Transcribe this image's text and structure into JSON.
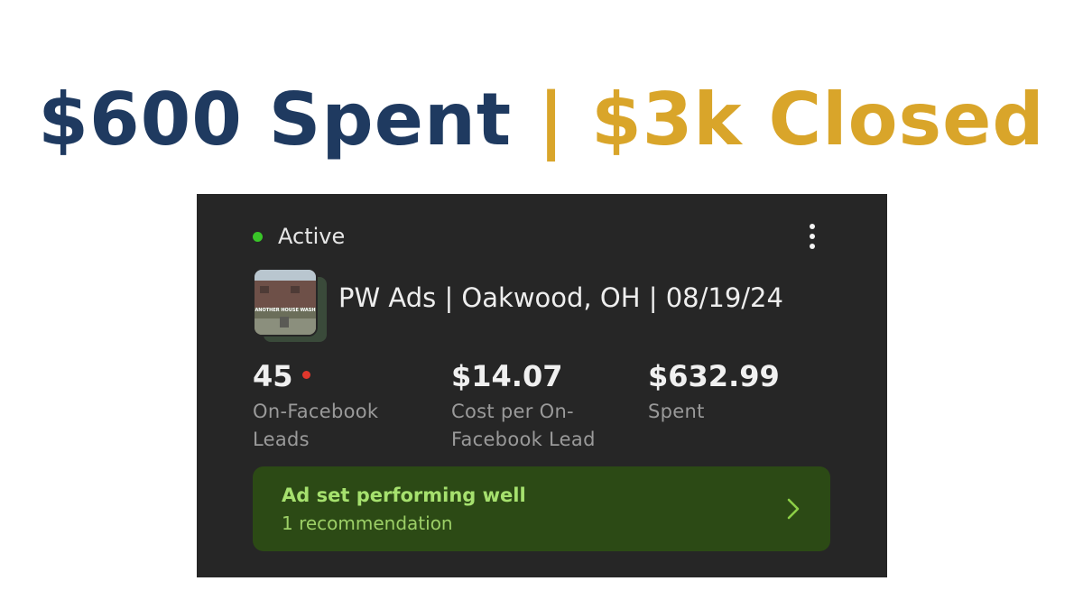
{
  "headline": {
    "spent_text": "$600 Spent",
    "closed_text": "| $3k Closed",
    "spent_color": "#1f3a60",
    "closed_color": "#d9a52a"
  },
  "card": {
    "status_label": "Active",
    "status_color": "#39c528",
    "menu_icon": "more-vertical-icon",
    "thumbnail_caption": "ANOTHER HOUSE WASH",
    "campaign_name": "PW Ads | Oakwood, OH | 08/19/24",
    "metrics": [
      {
        "value": "45",
        "label": "On-Facebook Leads",
        "has_alert_dot": true
      },
      {
        "value": "$14.07",
        "label": "Cost per On-Facebook Lead",
        "has_alert_dot": false
      },
      {
        "value": "$632.99",
        "label": "Spent",
        "has_alert_dot": false
      }
    ],
    "recommendation": {
      "title": "Ad set performing well",
      "subtitle": "1 recommendation",
      "icon": "chevron-right-icon",
      "accent_color": "#a6e16e"
    }
  }
}
